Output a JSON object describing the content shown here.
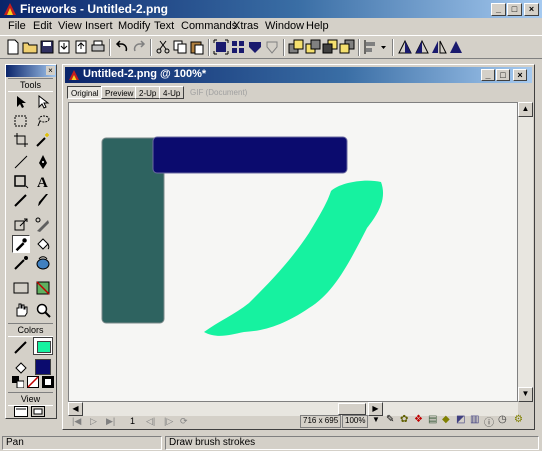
{
  "window": {
    "title": "Fireworks - Untitled-2.png",
    "controls": [
      "_",
      "□",
      "×"
    ]
  },
  "menu": [
    "File",
    "Edit",
    "View",
    "Insert",
    "Modify",
    "Text",
    "Commands",
    "Xtras",
    "Window",
    "Help"
  ],
  "tools_panel": {
    "title": "Tools",
    "colors_label": "Colors",
    "view_label": "View",
    "stroke_color": "#1a1a1a",
    "fill_color": "#16f2a0",
    "swatch_stroke": "#000000",
    "swatch_fill": "#0b0b6e"
  },
  "document": {
    "title": "Untitled-2.png @ 100%*",
    "tabs": [
      "Original",
      "Preview",
      "2-Up",
      "4-Up",
      "GIF (Document)"
    ],
    "page_number": "1",
    "canvas_size": "716 x 695",
    "zoom": "100%",
    "shapes": {
      "rect_teal": "#2e6360",
      "rect_navy": "#0b0b6e",
      "brush_green": "#16f2a0"
    }
  },
  "status": {
    "left": "Pan",
    "right": "Draw brush strokes"
  }
}
